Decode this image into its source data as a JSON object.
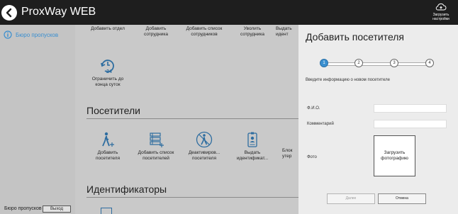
{
  "header": {
    "title": "ProxWay WEB",
    "upload_settings_label": "Загрузить настройки"
  },
  "sidebar": {
    "items": [
      {
        "label": "Бюро пропусков",
        "icon": "info-icon"
      }
    ],
    "user_label": "Бюро пропусков",
    "exit_label": "Выход"
  },
  "main": {
    "top_tiles": [
      {
        "label": "Добавить отдел"
      },
      {
        "label": "Добавить сотрудника"
      },
      {
        "label": "Добавить список сотрудников"
      },
      {
        "label": "Уволить сотрудника"
      },
      {
        "label": "Выдать идент"
      }
    ],
    "limit_tile": {
      "label": "Ограничить до конца суток",
      "icon_text": "24"
    },
    "visitors_section": {
      "title": "Посетители",
      "tiles": [
        {
          "label": "Добавить посетителя"
        },
        {
          "label": "Добавить список посетителей"
        },
        {
          "label": "Деактивиров... посетителя"
        },
        {
          "label": "Выдать идентификат..."
        },
        {
          "label": "Блок утер"
        }
      ]
    },
    "identifiers_section": {
      "title": "Идентификаторы"
    }
  },
  "dialog": {
    "title": "Добавить посетителя",
    "steps": [
      "1",
      "2",
      "3",
      "4"
    ],
    "active_step": 1,
    "intro": "Введите информацию о новом посетителе",
    "fields": {
      "name_label": "Ф.И.О.",
      "name_value": "",
      "comment_label": "Комментарий",
      "comment_value": "",
      "photo_label": "Фото"
    },
    "upload_photo_label": "Загрузить фотографию",
    "next_label": "Далее",
    "cancel_label": "Отмена"
  },
  "colors": {
    "accent": "#3a8fd0",
    "topbar": "#1e1e1e",
    "dialog_bg": "#ececec"
  }
}
